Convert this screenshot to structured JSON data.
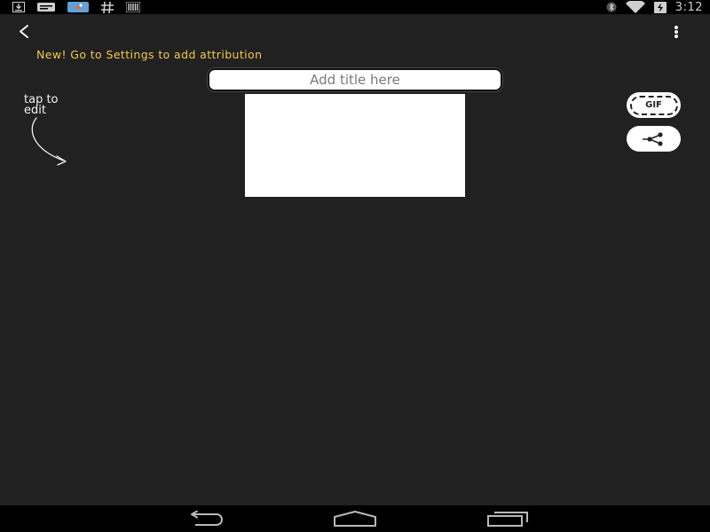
{
  "status_bar": {
    "left_icons": [
      "download-icon",
      "keyboard-icon",
      "app-notification-icon",
      "hashtag-icon",
      "barcode-icon"
    ],
    "right_icons": [
      "bluetooth-icon",
      "wifi-icon",
      "battery-charging-icon"
    ],
    "time": "3:12"
  },
  "toolbar": {
    "back_icon": "chevron-left-icon",
    "overflow_icon": "more-vertical-icon"
  },
  "notice": {
    "text": "New! Go to Settings to add attribution",
    "color": "#f2c94c"
  },
  "title_field": {
    "placeholder": "Add title here",
    "value": ""
  },
  "hint": {
    "text": "tap to\nedit"
  },
  "actions": {
    "gif_label": "GIF",
    "share_icon": "share-icon"
  },
  "nav_bar": {
    "icons": [
      "back-icon",
      "home-icon",
      "recents-icon"
    ]
  }
}
